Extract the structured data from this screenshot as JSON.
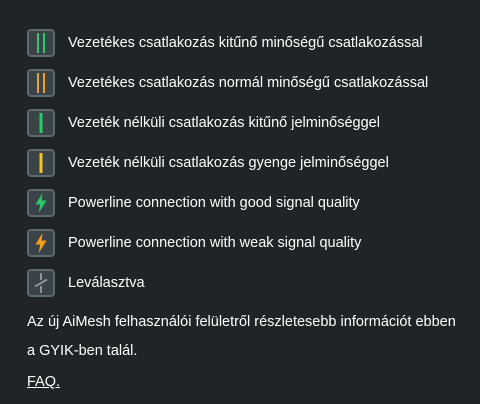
{
  "legend": [
    {
      "type": "wired",
      "icon": "wired-excellent-icon",
      "color": "#2ec76e",
      "label": "Vezetékes csatlakozás kitűnő minőségű csatlakozással"
    },
    {
      "type": "wired",
      "icon": "wired-normal-icon",
      "color": "#f0a01e",
      "label": "Vezetékes csatlakozás normál minőségű csatlakozással"
    },
    {
      "type": "wireless",
      "icon": "wireless-excellent-icon",
      "color": "#2ec76e",
      "label": "Vezeték nélküli csatlakozás kitűnő jelminőséggel"
    },
    {
      "type": "wireless",
      "icon": "wireless-weak-icon",
      "color": "#f0c432",
      "label": "Vezeték nélküli csatlakozás gyenge jelminőséggel"
    },
    {
      "type": "powerline",
      "icon": "powerline-good-icon",
      "color": "#2ec76e",
      "label": "Powerline connection with good signal quality"
    },
    {
      "type": "powerline",
      "icon": "powerline-weak-icon",
      "color": "#f0a01e",
      "label": "Powerline connection with weak signal quality"
    },
    {
      "type": "disconnected",
      "icon": "disconnected-icon",
      "color": "#8a9498",
      "label": "Leválasztva"
    }
  ],
  "note": "Az új AiMesh felhasználói felületről részletesebb információt ebben a GYIK-ben talál.",
  "faq_link": "FAQ."
}
